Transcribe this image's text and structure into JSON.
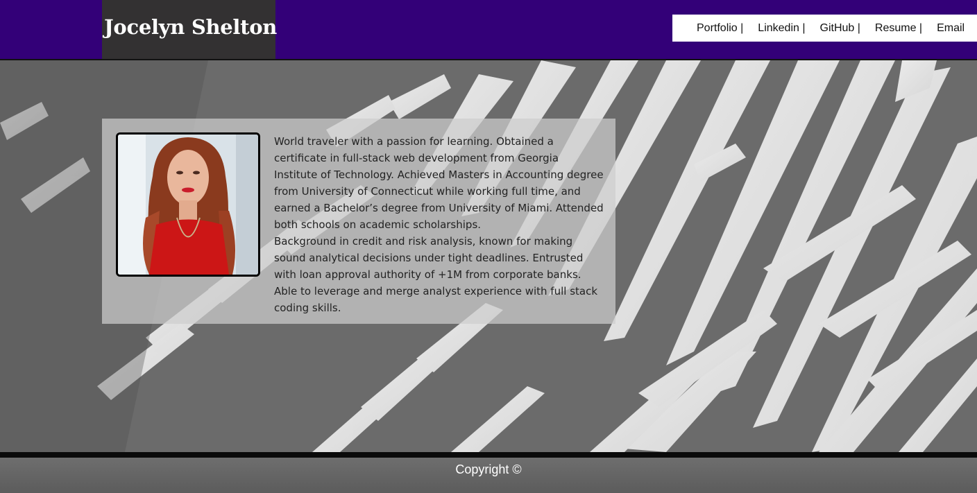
{
  "header": {
    "site_title": "Jocelyn Shelton",
    "brand_color": "#330078",
    "nav": [
      {
        "label": "Portfolio |"
      },
      {
        "label": "Linkedin |"
      },
      {
        "label": "GitHub |"
      },
      {
        "label": "Resume |"
      },
      {
        "label": "Email"
      }
    ]
  },
  "about": {
    "photo": "profile-photo",
    "paragraphs": [
      "World traveler with a passion for learning. Obtained a certificate in full-stack web development from Georgia Institute of Technology. Achieved Masters in Accounting degree from University of Connecticut while working full time, and earned a Bachelor’s degree from University of Miami. Attended both schools on academic scholarships.",
      "Background in credit and risk analysis, known for making sound analytical decisions under tight deadlines. Entrusted with loan approval authority of +1M from corporate banks. Able to leverage and merge analyst experience with full stack coding skills."
    ]
  },
  "footer": {
    "copyright": "Copyright ©"
  }
}
